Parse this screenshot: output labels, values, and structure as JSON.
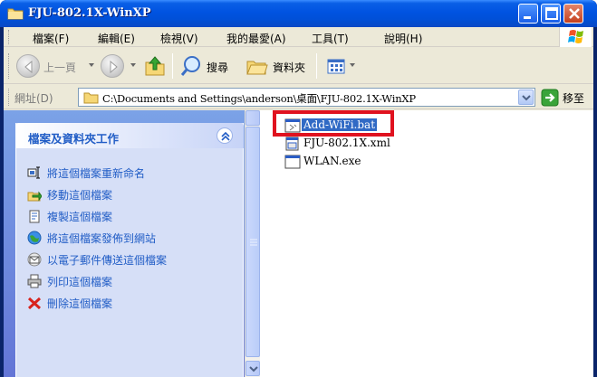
{
  "window": {
    "title": "FJU-802.1X-WinXP"
  },
  "menubar": {
    "items": [
      "檔案(F)",
      "編輯(E)",
      "檢視(V)",
      "我的最愛(A)",
      "工具(T)",
      "說明(H)"
    ]
  },
  "toolbar": {
    "back_label": "上一頁",
    "search_label": "搜尋",
    "folders_label": "資料夾"
  },
  "address": {
    "label": "網址(D)",
    "path": "C:\\Documents and Settings\\anderson\\桌面\\FJU-802.1X-WinXP",
    "go_label": "移至"
  },
  "tasks": {
    "header": "檔案及資料夾工作",
    "items": [
      {
        "label": "將這個檔案重新命名",
        "icon": "rename-icon"
      },
      {
        "label": "移動這個檔案",
        "icon": "move-icon"
      },
      {
        "label": "複製這個檔案",
        "icon": "copy-icon"
      },
      {
        "label": "將這個檔案發佈到網站",
        "icon": "publish-web-icon"
      },
      {
        "label": "以電子郵件傳送這個檔案",
        "icon": "email-icon"
      },
      {
        "label": "列印這個檔案",
        "icon": "print-icon"
      },
      {
        "label": "刪除這個檔案",
        "icon": "delete-icon"
      }
    ]
  },
  "files": [
    {
      "name": "Add-WiFi.bat",
      "icon": "batch-file-icon",
      "selected": true
    },
    {
      "name": "FJU-802.1X.xml",
      "icon": "xml-file-icon",
      "selected": false
    },
    {
      "name": "WLAN.exe",
      "icon": "exe-file-icon",
      "selected": false
    }
  ],
  "colors": {
    "title_bar": "#0053e1",
    "task_pane": "#7ba2e7",
    "task_link": "#215dc6",
    "selection": "#316ac5",
    "highlight": "#e0121f"
  }
}
